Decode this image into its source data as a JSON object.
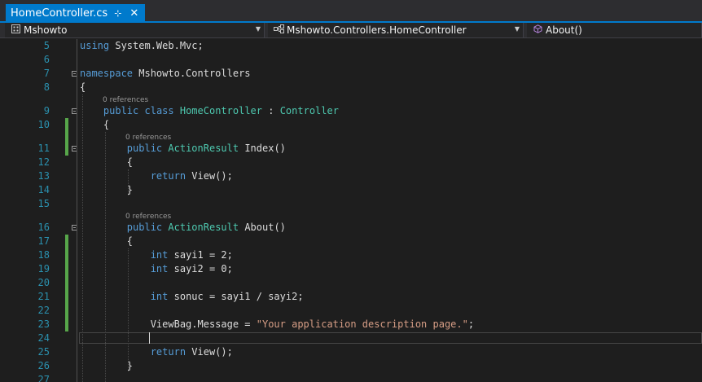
{
  "tab": {
    "title": "HomeController.cs",
    "pin_glyph": "⊹",
    "close_glyph": "✕"
  },
  "navbar": {
    "project": {
      "label": "Mshowto",
      "icon": "project-icon"
    },
    "class": {
      "label": "Mshowto.Controllers.HomeController",
      "icon": "class-icon"
    },
    "member": {
      "label": "About()",
      "icon": "method-icon"
    }
  },
  "colors": {
    "accent": "#007acc",
    "keyword": "#569cd6",
    "type": "#4ec9b0",
    "string": "#d69d85",
    "line_number": "#2b91af",
    "change_marker": "#57a64a"
  },
  "code_lens": "0 references",
  "lines": [
    {
      "num": "5",
      "tokens": [
        [
          "kw",
          "using"
        ],
        [
          "p",
          " System.Web.Mvc;"
        ]
      ]
    },
    {
      "num": "6",
      "tokens": []
    },
    {
      "num": "7",
      "tokens": [
        [
          "kw",
          "namespace"
        ],
        [
          "p",
          " Mshowto.Controllers"
        ]
      ]
    },
    {
      "num": "8",
      "tokens": [
        [
          "p",
          "{"
        ]
      ]
    },
    {
      "num": "9",
      "tokens": [
        [
          "p",
          "    "
        ],
        [
          "kw",
          "public"
        ],
        [
          "p",
          " "
        ],
        [
          "kw",
          "class"
        ],
        [
          "p",
          " "
        ],
        [
          "ty",
          "HomeController"
        ],
        [
          "p",
          " : "
        ],
        [
          "ty",
          "Controller"
        ]
      ]
    },
    {
      "num": "10",
      "tokens": [
        [
          "p",
          "    {"
        ]
      ]
    },
    {
      "num": "11",
      "tokens": [
        [
          "p",
          "        "
        ],
        [
          "kw",
          "public"
        ],
        [
          "p",
          " "
        ],
        [
          "ty",
          "ActionResult"
        ],
        [
          "p",
          " Index()"
        ]
      ]
    },
    {
      "num": "12",
      "tokens": [
        [
          "p",
          "        {"
        ]
      ]
    },
    {
      "num": "13",
      "tokens": [
        [
          "p",
          "            "
        ],
        [
          "kw",
          "return"
        ],
        [
          "p",
          " View();"
        ]
      ]
    },
    {
      "num": "14",
      "tokens": [
        [
          "p",
          "        }"
        ]
      ]
    },
    {
      "num": "15",
      "tokens": []
    },
    {
      "num": "16",
      "tokens": [
        [
          "p",
          "        "
        ],
        [
          "kw",
          "public"
        ],
        [
          "p",
          " "
        ],
        [
          "ty",
          "ActionResult"
        ],
        [
          "p",
          " About()"
        ]
      ]
    },
    {
      "num": "17",
      "tokens": [
        [
          "p",
          "        {"
        ]
      ]
    },
    {
      "num": "18",
      "tokens": [
        [
          "p",
          "            "
        ],
        [
          "kw",
          "int"
        ],
        [
          "p",
          " sayi1 = 2;"
        ]
      ]
    },
    {
      "num": "19",
      "tokens": [
        [
          "p",
          "            "
        ],
        [
          "kw",
          "int"
        ],
        [
          "p",
          " sayi2 = 0;"
        ]
      ]
    },
    {
      "num": "20",
      "tokens": []
    },
    {
      "num": "21",
      "tokens": [
        [
          "p",
          "            "
        ],
        [
          "kw",
          "int"
        ],
        [
          "p",
          " sonuc = sayi1 / sayi2;"
        ]
      ]
    },
    {
      "num": "22",
      "tokens": []
    },
    {
      "num": "23",
      "tokens": [
        [
          "p",
          "            ViewBag.Message = "
        ],
        [
          "st",
          "\"Your application description page.\""
        ],
        [
          "p",
          ";"
        ]
      ]
    },
    {
      "num": "24",
      "tokens": []
    },
    {
      "num": "25",
      "tokens": [
        [
          "p",
          "            "
        ],
        [
          "kw",
          "return"
        ],
        [
          "p",
          " View();"
        ]
      ]
    },
    {
      "num": "26",
      "tokens": [
        [
          "p",
          "        }"
        ]
      ]
    },
    {
      "num": "27",
      "tokens": []
    }
  ]
}
